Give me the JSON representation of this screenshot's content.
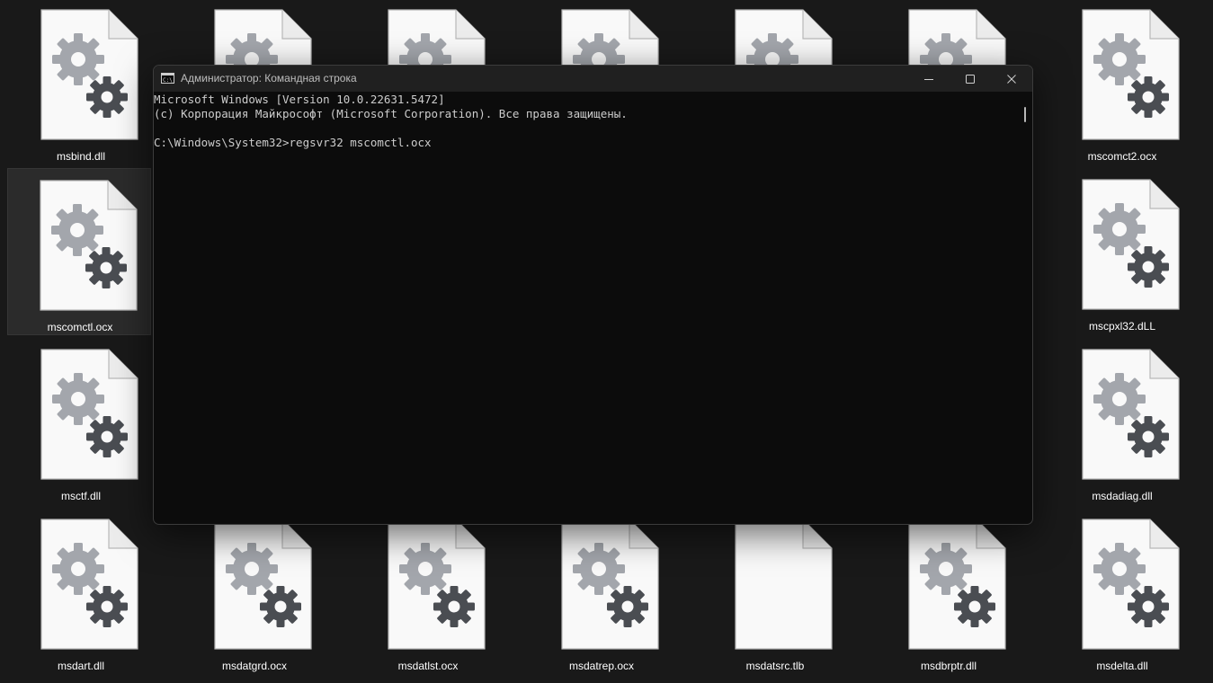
{
  "window": {
    "title": "Администратор: Командная строка",
    "icon": "cmd-icon",
    "buttons": [
      "minimize-icon",
      "maximize-icon",
      "close-icon"
    ]
  },
  "console": {
    "lines": [
      "Microsoft Windows [Version 10.0.22631.5472]",
      "(c) Корпорация Майкрософт (Microsoft Corporation). Все права защищены.",
      "",
      "C:\\Windows\\System32>regsvr32 mscomctl.ocx"
    ]
  },
  "desktop": {
    "files": [
      {
        "name": "msbind.dll",
        "icon": "gear-file-icon"
      },
      {
        "name": "",
        "icon": "gear-file-icon"
      },
      {
        "name": "",
        "icon": "gear-file-icon"
      },
      {
        "name": "",
        "icon": "gear-file-icon"
      },
      {
        "name": "",
        "icon": "gear-file-icon"
      },
      {
        "name": "",
        "icon": "gear-file-icon"
      },
      {
        "name": "mscomct2.ocx",
        "icon": "gear-file-icon"
      },
      {
        "name": "mscomctl.ocx",
        "icon": "gear-file-icon",
        "selected": true
      },
      {
        "name": "mscpxl32.dLL",
        "icon": "gear-file-icon"
      },
      {
        "name": "msctf.dll",
        "icon": "gear-file-icon"
      },
      {
        "name": "msdadiag.dll",
        "icon": "gear-file-icon"
      },
      {
        "name": "msdart.dll",
        "icon": "gear-file-icon"
      },
      {
        "name": "msdatgrd.ocx",
        "icon": "gear-file-icon"
      },
      {
        "name": "msdatlst.ocx",
        "icon": "gear-file-icon"
      },
      {
        "name": "msdatrep.ocx",
        "icon": "gear-file-icon"
      },
      {
        "name": "msdatsrc.tlb",
        "icon": "blank-file-icon"
      },
      {
        "name": "msdbrptr.dll",
        "icon": "gear-file-icon"
      },
      {
        "name": "msdelta.dll",
        "icon": "gear-file-icon"
      }
    ]
  },
  "colors": {
    "desktop_bg": "#191919",
    "console_bg": "#0c0c0c",
    "console_text": "#cccccc",
    "titlebar_bg": "#202020",
    "gear_light": "#a3a6ac",
    "gear_dark": "#4a4d52"
  }
}
